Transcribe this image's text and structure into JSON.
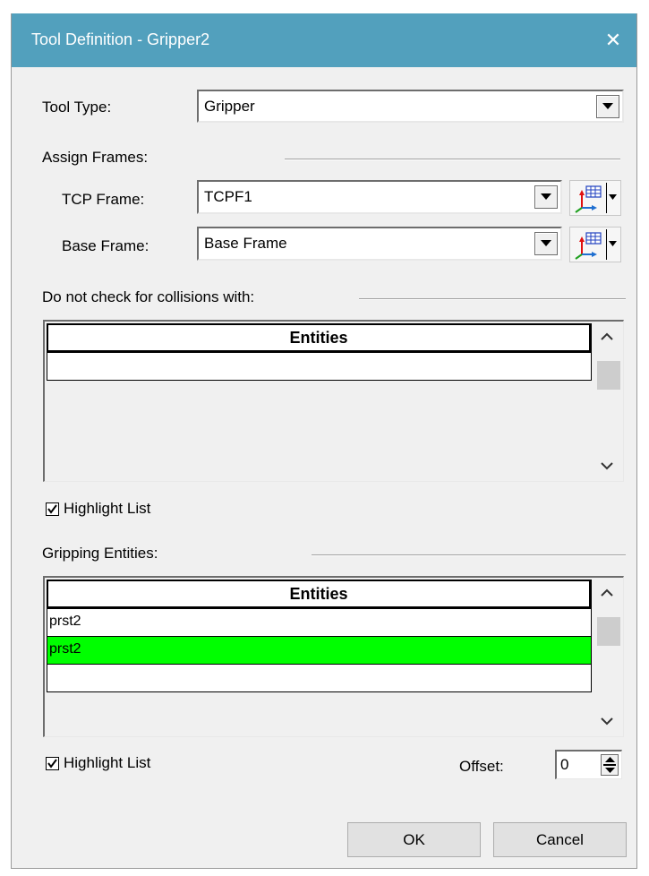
{
  "dialog": {
    "title": "Tool Definition - Gripper2",
    "close_glyph": "✕"
  },
  "tool_type": {
    "label": "Tool Type:",
    "value": "Gripper"
  },
  "assign_frames": {
    "label": "Assign Frames:",
    "tcp_label": "TCP Frame:",
    "tcp_value": "TCPF1",
    "base_label": "Base Frame:",
    "base_value": "Base Frame",
    "frame_button_icon": "frame-picker-icon"
  },
  "collisions": {
    "label": "Do not check for collisions with:",
    "column": "Entities",
    "rows": [
      ""
    ],
    "highlight_label": "Highlight List",
    "highlight_checked": true
  },
  "gripping": {
    "label": "Gripping Entities:",
    "column": "Entities",
    "rows": [
      "prst2",
      "prst2",
      ""
    ],
    "selected_row_color": "#00ff00",
    "highlight_label": "Highlight List",
    "highlight_checked": true,
    "offset_label": "Offset:",
    "offset_value": "0"
  },
  "buttons": {
    "ok": "OK",
    "cancel": "Cancel"
  },
  "colors": {
    "titlebar": "#52a0bd",
    "dialog_bg": "#f0f0f0",
    "highlight_row": "#00ff00"
  }
}
